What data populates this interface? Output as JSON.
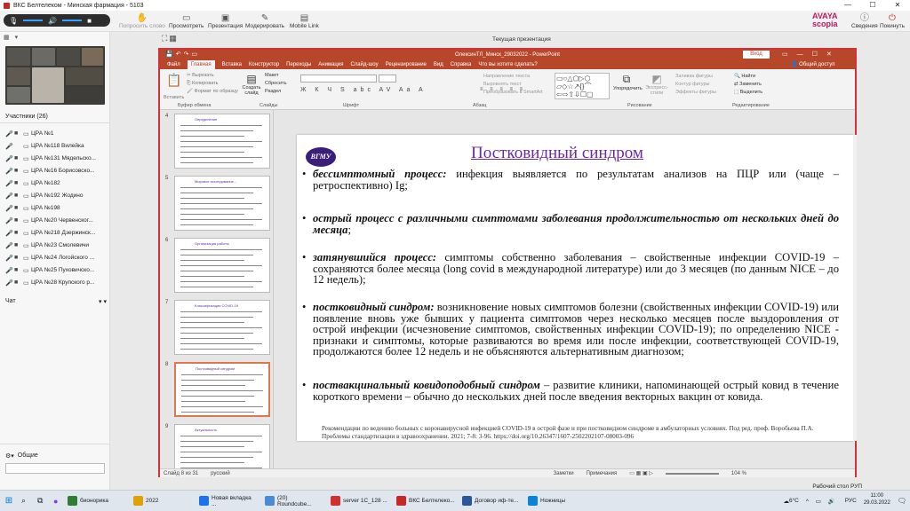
{
  "window": {
    "title": "ВКС Белтелеком - Минская фармация - 5103",
    "controls": [
      "—",
      "☐",
      "✕"
    ]
  },
  "toolbar": {
    "items": [
      "Попросить слово",
      "Просмотреть",
      "Презентация",
      "Модерировать",
      "Mobile Link"
    ],
    "brand": "AVAYA scopia",
    "right_items": [
      "Сведения",
      "Покинуть"
    ]
  },
  "sidebar": {
    "participants_header": "Участники (26)",
    "participants": [
      "ЦРА №1",
      "ЦРА №118 Вилейка",
      "ЦРА №131 Мядельско...",
      "ЦРА №16 Борисовско...",
      "ЦРА №182",
      "ЦРА №192 Жодино",
      "ЦРА №198",
      "ЦРА №20 Червенског...",
      "ЦРА №218 Дзержинск...",
      "ЦРА №23 Смолевичи",
      "ЦРА №24 Логойского ...",
      "ЦРА №25 Пуховичско...",
      "ЦРА №28 Крупского р..."
    ],
    "chat_header": "Чат",
    "polls_header": "Общие"
  },
  "main": {
    "header": "Текущая презентация"
  },
  "ppt": {
    "title": "ОлексинТЛ_Минск_29032022 - PowerPoint",
    "login": "Вход",
    "tabs": [
      "Файл",
      "Главная",
      "Вставка",
      "Конструктор",
      "Переходы",
      "Анимация",
      "Слайд-шоу",
      "Рецензирование",
      "Вид",
      "Справка",
      "Что вы хотите сделать?"
    ],
    "share": "Общий доступ",
    "ribbon_groups": [
      "Буфер обмена",
      "Слайды",
      "Шрифт",
      "Абзац",
      "Рисование",
      "Редактирование"
    ],
    "ribbon_buttons": [
      "Вставить",
      "Вырезать",
      "Копировать",
      "Формат по образцу",
      "Создать слайд",
      "Макет",
      "Сбросить",
      "Раздел",
      "Упорядочить",
      "Экспресс-стили",
      "Найти",
      "Заменить",
      "Выделить",
      "Направление текста",
      "Выровнять текст",
      "Преобразовать в SmartArt",
      "Заливка фигуры",
      "Контур фигуры",
      "Эффекты фигуры"
    ],
    "thumbs": [
      {
        "num": "4",
        "title": "Определение"
      },
      {
        "num": "5",
        "title": "Мировое исследование..."
      },
      {
        "num": "6",
        "title": "Организация работы"
      },
      {
        "num": "7",
        "title": "Классификация COVID-19"
      },
      {
        "num": "8",
        "title": "Постковидный синдром"
      },
      {
        "num": "9",
        "title": "Актуальность"
      }
    ],
    "status": {
      "slide": "Слайд 8 из 31",
      "lang": "русский",
      "notes": "Заметки",
      "comments": "Примечания",
      "zoom": "104 %"
    }
  },
  "slide": {
    "logo": "ВГМУ",
    "title": "Постковидный синдром",
    "bullets": [
      {
        "term": "бессимптомный процесс:",
        "text": " инфекция выявляется по результатам анализов на ПЦР или (чаще – ретроспективно) Ig;"
      },
      {
        "term": "острый процесс с различными симптомами заболевания продолжительностью от нескольких дней до месяца",
        "text": ";"
      },
      {
        "term": "затянувшийся процесс:",
        "text": " симптомы собственно заболевания – свойственные инфекции COVID-19 – сохраняются более месяца (long covid в международной литературе) или до 3 месяцев (по данным NICE – до 12 недель);"
      },
      {
        "term": "постковидный синдром:",
        "text": " возникновение новых симптомов болезни (свойственных инфекции COVID-19) или появление вновь уже бывших у пациента симптомов через несколько месяцев после выздоровления от острой инфекции (исчезновение симптомов, свойственных инфекции COVID-19); по определению NICE - признаки и симптомы, которые развиваются во время или после инфекции, соответствующей COVID-19, продолжаются более 12 недель и не объясняются альтернативным диагнозом;"
      },
      {
        "term": "поствакцинальный ковидоподобный синдром",
        "text": " – развитие клиники, напоминающей острый ковид в течение короткого времени – обычно до нескольких дней после введения векторных вакцин от ковида."
      }
    ],
    "reference": "Рекомендации по ведению больных с коронавирусной инфекцией COVID-19 в острой фазе и при постковидном синдроме в амбулаторных условиях. Под ред. проф. Воробьева П.А. Проблемы стандартизации в здравоохранении. 2021; 7-8: 3-96. https://doi.org/10.26347/1607-2502202107-08003-096"
  },
  "taskbar": {
    "items": [
      "бионорика",
      "2022",
      "Новая вкладка ...",
      "(20) Roundcube...",
      "server 1С_128 ...",
      "ВКС Белтелеко...",
      "Договор иф-те...",
      "Ножницы"
    ],
    "desktop": "Рабочий стол РУП",
    "weather": "6°C",
    "lang": "РУС",
    "time": "11:00",
    "date": "29.03.2022"
  }
}
